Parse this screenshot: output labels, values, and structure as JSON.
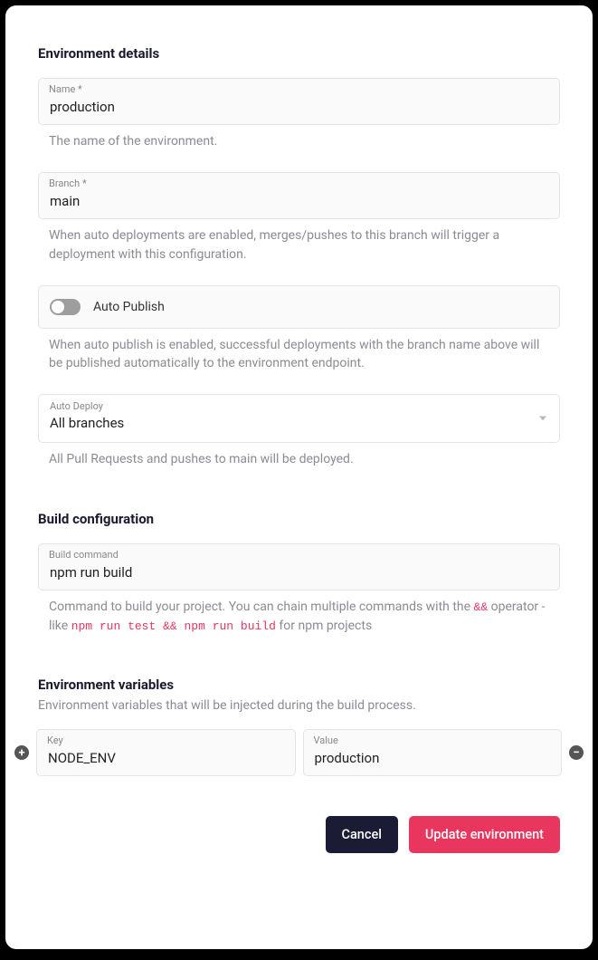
{
  "sections": {
    "env_details": {
      "title": "Environment details"
    },
    "build_config": {
      "title": "Build configuration"
    },
    "env_vars": {
      "title": "Environment variables",
      "description": "Environment variables that will be injected during the build process."
    }
  },
  "fields": {
    "name": {
      "label": "Name *",
      "value": "production",
      "help": "The name of the environment."
    },
    "branch": {
      "label": "Branch *",
      "value": "main",
      "help": "When auto deployments are enabled, merges/pushes to this branch will trigger a deployment with this configuration."
    },
    "auto_publish": {
      "label": "Auto Publish",
      "checked": false,
      "help": "When auto publish is enabled, successful deployments with the branch name above will be published automatically to the environment endpoint."
    },
    "auto_deploy": {
      "label": "Auto Deploy",
      "value": "All branches",
      "help": "All Pull Requests and pushes to main will be deployed."
    },
    "build_command": {
      "label": "Build command",
      "value": "npm run build",
      "help_pre": "Command to build your project. You can chain multiple commands with the ",
      "help_code1": "&&",
      "help_mid": " operator - like ",
      "help_code2": "npm run test && npm run build",
      "help_post": " for npm projects"
    }
  },
  "env_var_row": {
    "key_label": "Key",
    "key_value": "NODE_ENV",
    "value_label": "Value",
    "value_value": "production"
  },
  "icons": {
    "add": "+",
    "remove": "−"
  },
  "buttons": {
    "cancel": "Cancel",
    "update": "Update environment"
  }
}
